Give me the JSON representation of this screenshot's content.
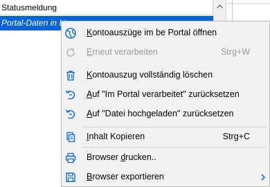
{
  "list": {
    "column_header": "Statusmeldung",
    "selected_row_text": "Portal-Daten in Ltu"
  },
  "menu": {
    "items": [
      {
        "key": "K",
        "rest": "ontoauszüge im be Portal öffnen",
        "shortcut": "",
        "icon": "globe-icon",
        "enabled": true
      },
      {
        "key": "E",
        "rest": "rneut verarbeiten",
        "shortcut": "Strg+W",
        "icon": "refresh-icon",
        "enabled": false
      },
      {
        "key": "K",
        "rest": "ontoauszug vollständig löschen",
        "shortcut": "",
        "icon": "trash-icon",
        "enabled": true
      },
      {
        "key": "A",
        "rest": "uf \"Im Portal verarbeitet\" zurücksetzen",
        "shortcut": "",
        "icon": "undo-icon",
        "enabled": true
      },
      {
        "key": "A",
        "rest": "uf \"Datei hochgeladen\" zurücksetzen",
        "shortcut": "",
        "icon": "undo-icon",
        "enabled": true
      },
      {
        "key": "I",
        "rest": "nhalt Kopieren",
        "shortcut": "Strg+C",
        "icon": "copy-icon",
        "enabled": true
      },
      {
        "pre": "Browser ",
        "key": "d",
        "rest": "rucken..",
        "shortcut": "",
        "icon": "printer-icon",
        "enabled": true
      },
      {
        "key": "B",
        "rest": "rowser exportieren",
        "shortcut": "",
        "icon": "save-icon",
        "enabled": true
      }
    ]
  },
  "colors": {
    "selection": "#0a64d6",
    "icon_blue": "#1a6fd6",
    "menu_bg": "#f2f2f2",
    "disabled_text": "#9a9a9a"
  }
}
